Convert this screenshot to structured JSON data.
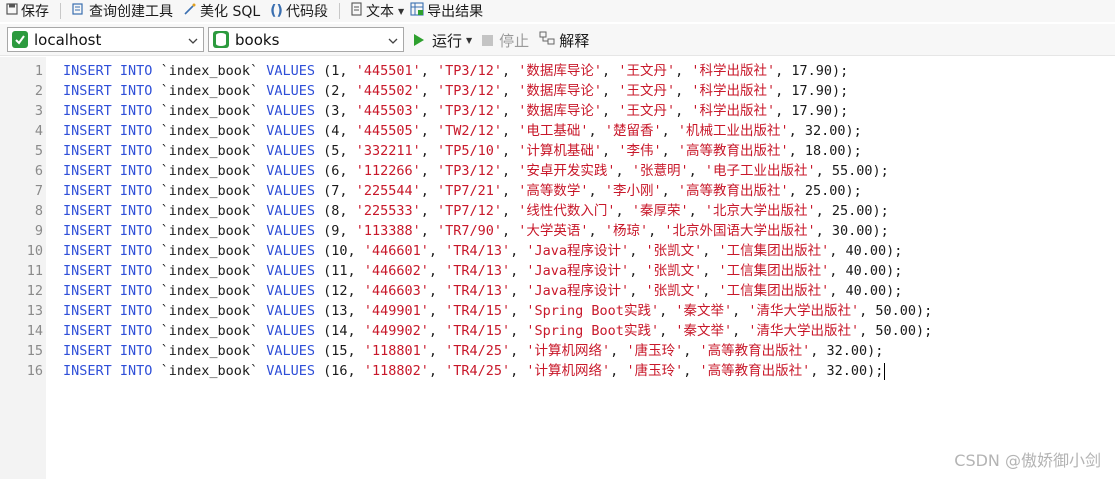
{
  "toolbar": {
    "save": "保存",
    "query_builder": "查询创建工具",
    "beautify_sql": "美化 SQL",
    "code_snippet": "代码段",
    "text": "文本",
    "export_result": "导出结果"
  },
  "connection": {
    "selected": "localhost"
  },
  "database": {
    "selected": "books"
  },
  "actions": {
    "run": "运行",
    "stop": "停止",
    "explain": "解释"
  },
  "editor": {
    "line_numbers": [
      "1",
      "2",
      "3",
      "4",
      "5",
      "6",
      "7",
      "8",
      "9",
      "10",
      "11",
      "12",
      "13",
      "14",
      "15",
      "16"
    ],
    "lines": [
      {
        "id": "1",
        "code": "445501",
        "cls": "TP3/12",
        "name": "数据库导论",
        "author": "王文丹",
        "press": "科学出版社",
        "price": "17.90"
      },
      {
        "id": "2",
        "code": "445502",
        "cls": "TP3/12",
        "name": "数据库导论",
        "author": "王文丹",
        "press": "科学出版社",
        "price": "17.90"
      },
      {
        "id": "3",
        "code": "445503",
        "cls": "TP3/12",
        "name": "数据库导论",
        "author": "王文丹",
        "press": "科学出版社",
        "price": "17.90"
      },
      {
        "id": "4",
        "code": "445505",
        "cls": "TW2/12",
        "name": "电工基础",
        "author": "楚留香",
        "press": "机械工业出版社",
        "price": "32.00"
      },
      {
        "id": "5",
        "code": "332211",
        "cls": "TP5/10",
        "name": "计算机基础",
        "author": "李伟",
        "press": "高等教育出版社",
        "price": "18.00"
      },
      {
        "id": "6",
        "code": "112266",
        "cls": "TP3/12",
        "name": "安卓开发实践",
        "author": "张薏明",
        "press": "电子工业出版社",
        "price": "55.00"
      },
      {
        "id": "7",
        "code": "225544",
        "cls": "TP7/21",
        "name": "高等数学",
        "author": "李小刚",
        "press": "高等教育出版社",
        "price": "25.00"
      },
      {
        "id": "8",
        "code": "225533",
        "cls": "TP7/12",
        "name": "线性代数入门",
        "author": "秦厚荣",
        "press": "北京大学出版社",
        "price": "25.00"
      },
      {
        "id": "9",
        "code": "113388",
        "cls": "TR7/90",
        "name": "大学英语",
        "author": "杨琼",
        "press": "北京外国语大学出版社",
        "price": "30.00"
      },
      {
        "id": "10",
        "code": "446601",
        "cls": "TR4/13",
        "name": "Java程序设计",
        "author": "张凯文",
        "press": "工信集团出版社",
        "price": "40.00"
      },
      {
        "id": "11",
        "code": "446602",
        "cls": "TR4/13",
        "name": "Java程序设计",
        "author": "张凯文",
        "press": "工信集团出版社",
        "price": "40.00"
      },
      {
        "id": "12",
        "code": "446603",
        "cls": "TR4/13",
        "name": "Java程序设计",
        "author": "张凯文",
        "press": "工信集团出版社",
        "price": "40.00"
      },
      {
        "id": "13",
        "code": "449901",
        "cls": "TR4/15",
        "name": "Spring Boot实践",
        "author": "秦文举",
        "press": "清华大学出版社",
        "price": "50.00"
      },
      {
        "id": "14",
        "code": "449902",
        "cls": "TR4/15",
        "name": "Spring Boot实践",
        "author": "秦文举",
        "press": "清华大学出版社",
        "price": "50.00"
      },
      {
        "id": "15",
        "code": "118801",
        "cls": "TR4/25",
        "name": "计算机网络",
        "author": "唐玉玲",
        "press": "高等教育出版社",
        "price": "32.00"
      },
      {
        "id": "16",
        "code": "118802",
        "cls": "TR4/25",
        "name": "计算机网络",
        "author": "唐玉玲",
        "press": "高等教育出版社",
        "price": "32.00"
      }
    ],
    "keyword_insert": "INSERT",
    "keyword_into": "INTO",
    "keyword_values": "VALUES",
    "table_name": "`index_book`"
  },
  "watermark": "CSDN @傲娇御小剑",
  "colors": {
    "keyword": "#2f4fd8",
    "string": "#c8182a",
    "run_icon": "#2ea02e",
    "db_icon": "#2c9a3e"
  }
}
